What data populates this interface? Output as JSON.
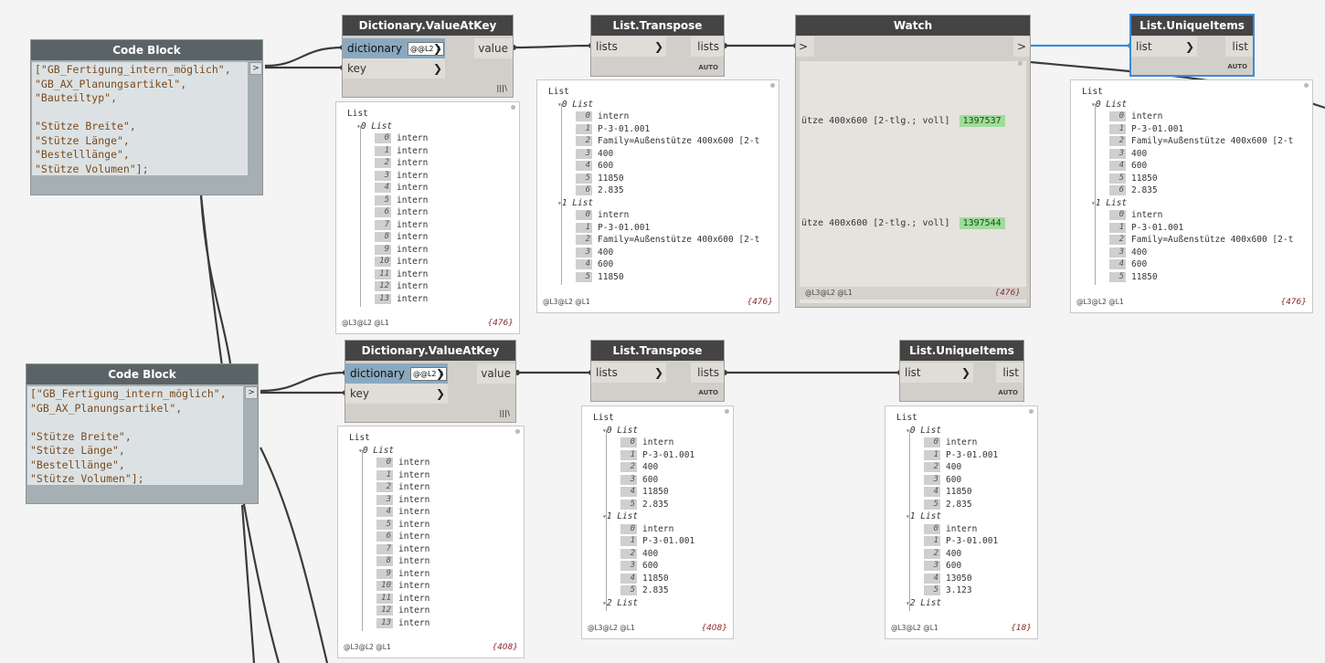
{
  "colors": {
    "wire": "#3b3b3b",
    "wire_selected": "#3d8bd6",
    "node_header": "#444444",
    "count": "#8b2a2a",
    "watch_value": "#9fdc9a"
  },
  "code_block_top": {
    "title": "Code Block",
    "lines": [
      "[\"GB_Fertigung_intern_möglich\",",
      "\"GB_AX_Planungsartikel\",",
      "\"Bauteiltyp\",",
      "",
      "\"Stütze Breite\",",
      "\"Stütze Länge\",",
      "\"Bestelllänge\",",
      "\"Stütze Volumen\"];"
    ],
    "out": ">"
  },
  "code_block_bottom": {
    "title": "Code Block",
    "lines": [
      "[\"GB_Fertigung_intern_möglich\",",
      "\"GB_AX_Planungsartikel\",",
      "",
      "\"Stütze Breite\",",
      "\"Stütze Länge\",",
      "\"Bestelllänge\",",
      "\"Stütze Volumen\"];"
    ],
    "out": ">"
  },
  "dict_top": {
    "title": "Dictionary.ValueAtKey",
    "in1": "dictionary",
    "in2": "key",
    "out": "value",
    "lace": "|||\\",
    "spin": "@@L2"
  },
  "dict_bottom": {
    "title": "Dictionary.ValueAtKey",
    "in1": "dictionary",
    "in2": "key",
    "out": "value",
    "lace": "|||\\",
    "spin": "@@L2"
  },
  "transpose_top": {
    "title": "List.Transpose",
    "in": "lists",
    "out": "lists",
    "lace": "AUTO"
  },
  "transpose_bottom": {
    "title": "List.Transpose",
    "in": "lists",
    "out": "lists",
    "lace": "AUTO"
  },
  "watch": {
    "title": "Watch",
    "in": ">",
    "out": ">",
    "values": [
      {
        "text": "ütze 400x600 [2-tlg.; voll]",
        "num": "1397537"
      },
      {
        "text": "ütze 400x600 [2-tlg.; voll]",
        "num": "1397544"
      }
    ],
    "foot": "@L3@L2 @L1",
    "count": "{476}"
  },
  "unique_top": {
    "title": "List.UniqueItems",
    "in": "list",
    "out": "list",
    "lace": "AUTO"
  },
  "unique_bottom": {
    "title": "List.UniqueItems",
    "in": "list",
    "out": "list",
    "lace": "AUTO"
  },
  "preview_dict_top": {
    "foot": "@L3@L2 @L1",
    "count": "{476}",
    "lines": [
      {
        "t": "List",
        "x": 0
      },
      {
        "t": "0 List",
        "x": 10,
        "tri": true,
        "iidx": true
      },
      {
        "i": "0",
        "v": "intern",
        "x": 30
      },
      {
        "i": "1",
        "v": "intern",
        "x": 30
      },
      {
        "i": "2",
        "v": "intern",
        "x": 30
      },
      {
        "i": "3",
        "v": "intern",
        "x": 30
      },
      {
        "i": "4",
        "v": "intern",
        "x": 30
      },
      {
        "i": "5",
        "v": "intern",
        "x": 30
      },
      {
        "i": "6",
        "v": "intern",
        "x": 30
      },
      {
        "i": "7",
        "v": "intern",
        "x": 30
      },
      {
        "i": "8",
        "v": "intern",
        "x": 30
      },
      {
        "i": "9",
        "v": "intern",
        "x": 30
      },
      {
        "i": "10",
        "v": "intern",
        "x": 30
      },
      {
        "i": "11",
        "v": "intern",
        "x": 30
      },
      {
        "i": "12",
        "v": "intern",
        "x": 30
      },
      {
        "i": "13",
        "v": "intern",
        "x": 30
      }
    ]
  },
  "preview_transpose_top": {
    "foot": "@L3@L2 @L1",
    "count": "{476}",
    "lines": [
      {
        "t": "List",
        "x": 0
      },
      {
        "t": "0 List",
        "x": 10,
        "tri": true
      },
      {
        "i": "0",
        "v": "intern",
        "x": 30
      },
      {
        "i": "1",
        "v": "P-3-01.001",
        "x": 30
      },
      {
        "i": "2",
        "v": "Family=Außenstütze 400x600 [2-t",
        "x": 30
      },
      {
        "i": "3",
        "v": "400",
        "x": 30
      },
      {
        "i": "4",
        "v": "600",
        "x": 30
      },
      {
        "i": "5",
        "v": "11850",
        "x": 30
      },
      {
        "i": "6",
        "v": "2.835",
        "x": 30
      },
      {
        "t": "1 List",
        "x": 10,
        "tri": true
      },
      {
        "i": "0",
        "v": "intern",
        "x": 30
      },
      {
        "i": "1",
        "v": "P-3-01.001",
        "x": 30
      },
      {
        "i": "2",
        "v": "Family=Außenstütze 400x600 [2-t",
        "x": 30
      },
      {
        "i": "3",
        "v": "400",
        "x": 30
      },
      {
        "i": "4",
        "v": "600",
        "x": 30
      },
      {
        "i": "5",
        "v": "11850",
        "x": 30
      }
    ]
  },
  "preview_unique_top": {
    "foot": "@L3@L2 @L1",
    "count": "{476}",
    "lines": [
      {
        "t": "List",
        "x": 0
      },
      {
        "t": "0 List",
        "x": 10,
        "tri": true
      },
      {
        "i": "0",
        "v": "intern",
        "x": 30
      },
      {
        "i": "1",
        "v": "P-3-01.001",
        "x": 30
      },
      {
        "i": "2",
        "v": "Family=Außenstütze 400x600 [2-t",
        "x": 30
      },
      {
        "i": "3",
        "v": "400",
        "x": 30
      },
      {
        "i": "4",
        "v": "600",
        "x": 30
      },
      {
        "i": "5",
        "v": "11850",
        "x": 30
      },
      {
        "i": "6",
        "v": "2.835",
        "x": 30
      },
      {
        "t": "1 List",
        "x": 10,
        "tri": true
      },
      {
        "i": "0",
        "v": "intern",
        "x": 30
      },
      {
        "i": "1",
        "v": "P-3-01.001",
        "x": 30
      },
      {
        "i": "2",
        "v": "Family=Außenstütze 400x600 [2-t",
        "x": 30
      },
      {
        "i": "3",
        "v": "400",
        "x": 30
      },
      {
        "i": "4",
        "v": "600",
        "x": 30
      },
      {
        "i": "5",
        "v": "11850",
        "x": 30
      }
    ]
  },
  "preview_dict_bottom": {
    "foot": "@L3@L2 @L1",
    "count": "{408}",
    "lines": [
      {
        "t": "List",
        "x": 0
      },
      {
        "t": "0 List",
        "x": 10,
        "tri": true
      },
      {
        "i": "0",
        "v": "intern",
        "x": 30
      },
      {
        "i": "1",
        "v": "intern",
        "x": 30
      },
      {
        "i": "2",
        "v": "intern",
        "x": 30
      },
      {
        "i": "3",
        "v": "intern",
        "x": 30
      },
      {
        "i": "4",
        "v": "intern",
        "x": 30
      },
      {
        "i": "5",
        "v": "intern",
        "x": 30
      },
      {
        "i": "6",
        "v": "intern",
        "x": 30
      },
      {
        "i": "7",
        "v": "intern",
        "x": 30
      },
      {
        "i": "8",
        "v": "intern",
        "x": 30
      },
      {
        "i": "9",
        "v": "intern",
        "x": 30
      },
      {
        "i": "10",
        "v": "intern",
        "x": 30
      },
      {
        "i": "11",
        "v": "intern",
        "x": 30
      },
      {
        "i": "12",
        "v": "intern",
        "x": 30
      },
      {
        "i": "13",
        "v": "intern",
        "x": 30
      }
    ]
  },
  "preview_transpose_bottom": {
    "foot": "@L3@L2 @L1",
    "count": "{408}",
    "lines": [
      {
        "t": "List",
        "x": 0
      },
      {
        "t": "0 List",
        "x": 10,
        "tri": true
      },
      {
        "i": "0",
        "v": "intern",
        "x": 30
      },
      {
        "i": "1",
        "v": "P-3-01.001",
        "x": 30
      },
      {
        "i": "2",
        "v": "400",
        "x": 30
      },
      {
        "i": "3",
        "v": "600",
        "x": 30
      },
      {
        "i": "4",
        "v": "11850",
        "x": 30
      },
      {
        "i": "5",
        "v": "2.835",
        "x": 30
      },
      {
        "t": "1 List",
        "x": 10,
        "tri": true
      },
      {
        "i": "0",
        "v": "intern",
        "x": 30
      },
      {
        "i": "1",
        "v": "P-3-01.001",
        "x": 30
      },
      {
        "i": "2",
        "v": "400",
        "x": 30
      },
      {
        "i": "3",
        "v": "600",
        "x": 30
      },
      {
        "i": "4",
        "v": "11850",
        "x": 30
      },
      {
        "i": "5",
        "v": "2.835",
        "x": 30
      },
      {
        "t": "2 List",
        "x": 10,
        "tri": true
      }
    ]
  },
  "preview_unique_bottom": {
    "foot": "@L3@L2 @L1",
    "count": "{18}",
    "lines": [
      {
        "t": "List",
        "x": 0
      },
      {
        "t": "0 List",
        "x": 10,
        "tri": true
      },
      {
        "i": "0",
        "v": "intern",
        "x": 30
      },
      {
        "i": "1",
        "v": "P-3-01.001",
        "x": 30
      },
      {
        "i": "2",
        "v": "400",
        "x": 30
      },
      {
        "i": "3",
        "v": "600",
        "x": 30
      },
      {
        "i": "4",
        "v": "11850",
        "x": 30
      },
      {
        "i": "5",
        "v": "2.835",
        "x": 30
      },
      {
        "t": "1 List",
        "x": 10,
        "tri": true
      },
      {
        "i": "0",
        "v": "intern",
        "x": 30
      },
      {
        "i": "1",
        "v": "P-3-01.001",
        "x": 30
      },
      {
        "i": "2",
        "v": "400",
        "x": 30
      },
      {
        "i": "3",
        "v": "600",
        "x": 30
      },
      {
        "i": "4",
        "v": "13050",
        "x": 30
      },
      {
        "i": "5",
        "v": "3.123",
        "x": 30
      },
      {
        "t": "2 List",
        "x": 10,
        "tri": true
      }
    ]
  }
}
